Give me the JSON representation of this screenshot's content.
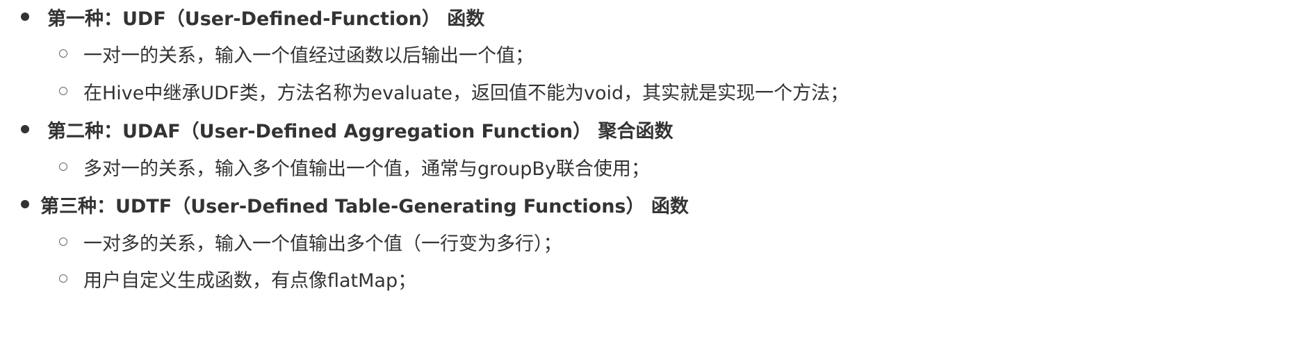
{
  "items": [
    {
      "label": "第一种：UDF（User-Defined-Function） 函数",
      "children": [
        "一对一的关系，输入一个值经过函数以后输出一个值；",
        "在Hive中继承UDF类，方法名称为evaluate，返回值不能为void，其实就是实现一个方法；"
      ]
    },
    {
      "label": "第二种：UDAF（User-Defined Aggregation Function） 聚合函数",
      "children": [
        "多对一的关系，输入多个值输出一个值，通常与groupBy联合使用；"
      ]
    },
    {
      "label": "第三种：UDTF（User-Defined Table-Generating Functions） 函数",
      "children": [
        "一对多的关系，输入一个值输出多个值（一行变为多行）；",
        "用户自定义生成函数，有点像flatMap；"
      ]
    }
  ]
}
